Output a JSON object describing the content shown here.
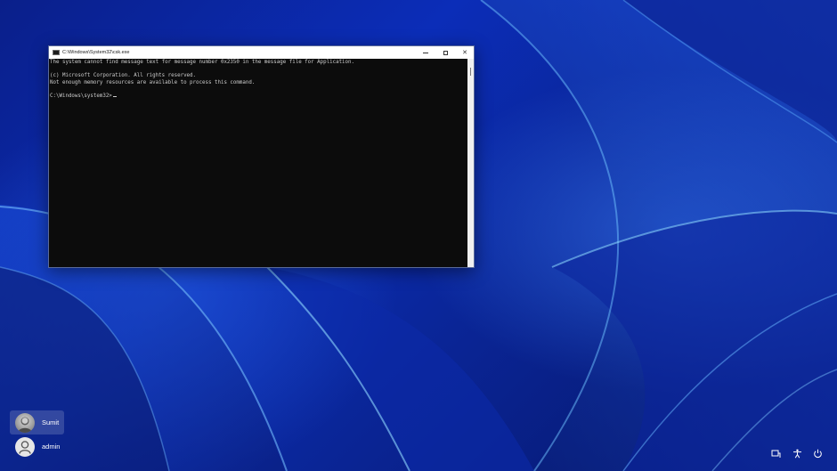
{
  "window": {
    "title": "C:\\Windows\\System32\\csk.exe",
    "icon": "console-app-icon",
    "controls": {
      "minimize": "minimize-icon",
      "maximize": "maximize-icon",
      "close": "✕"
    }
  },
  "console": {
    "lines": [
      "The system cannot find message text for message number 0x2350 in the message file for Application.",
      "",
      "(c) Microsoft Corporation. All rights reserved.",
      "Not enough memory resources are available to process this command.",
      "",
      "C:\\Windows\\system32>"
    ],
    "text_color": "#cccccc",
    "background_color": "#0c0c0c"
  },
  "users": [
    {
      "name": "Sumit",
      "avatar": "photo-avatar",
      "selected": true
    },
    {
      "name": "admin",
      "avatar": "default-person-icon",
      "selected": false
    }
  ],
  "system_icons": [
    "network-icon",
    "accessibility-icon",
    "power-icon"
  ],
  "colors": {
    "wallpaper_primary": "#0b2db8",
    "wallpaper_dark": "#061566",
    "wallpaper_highlight": "#3c82ff"
  }
}
